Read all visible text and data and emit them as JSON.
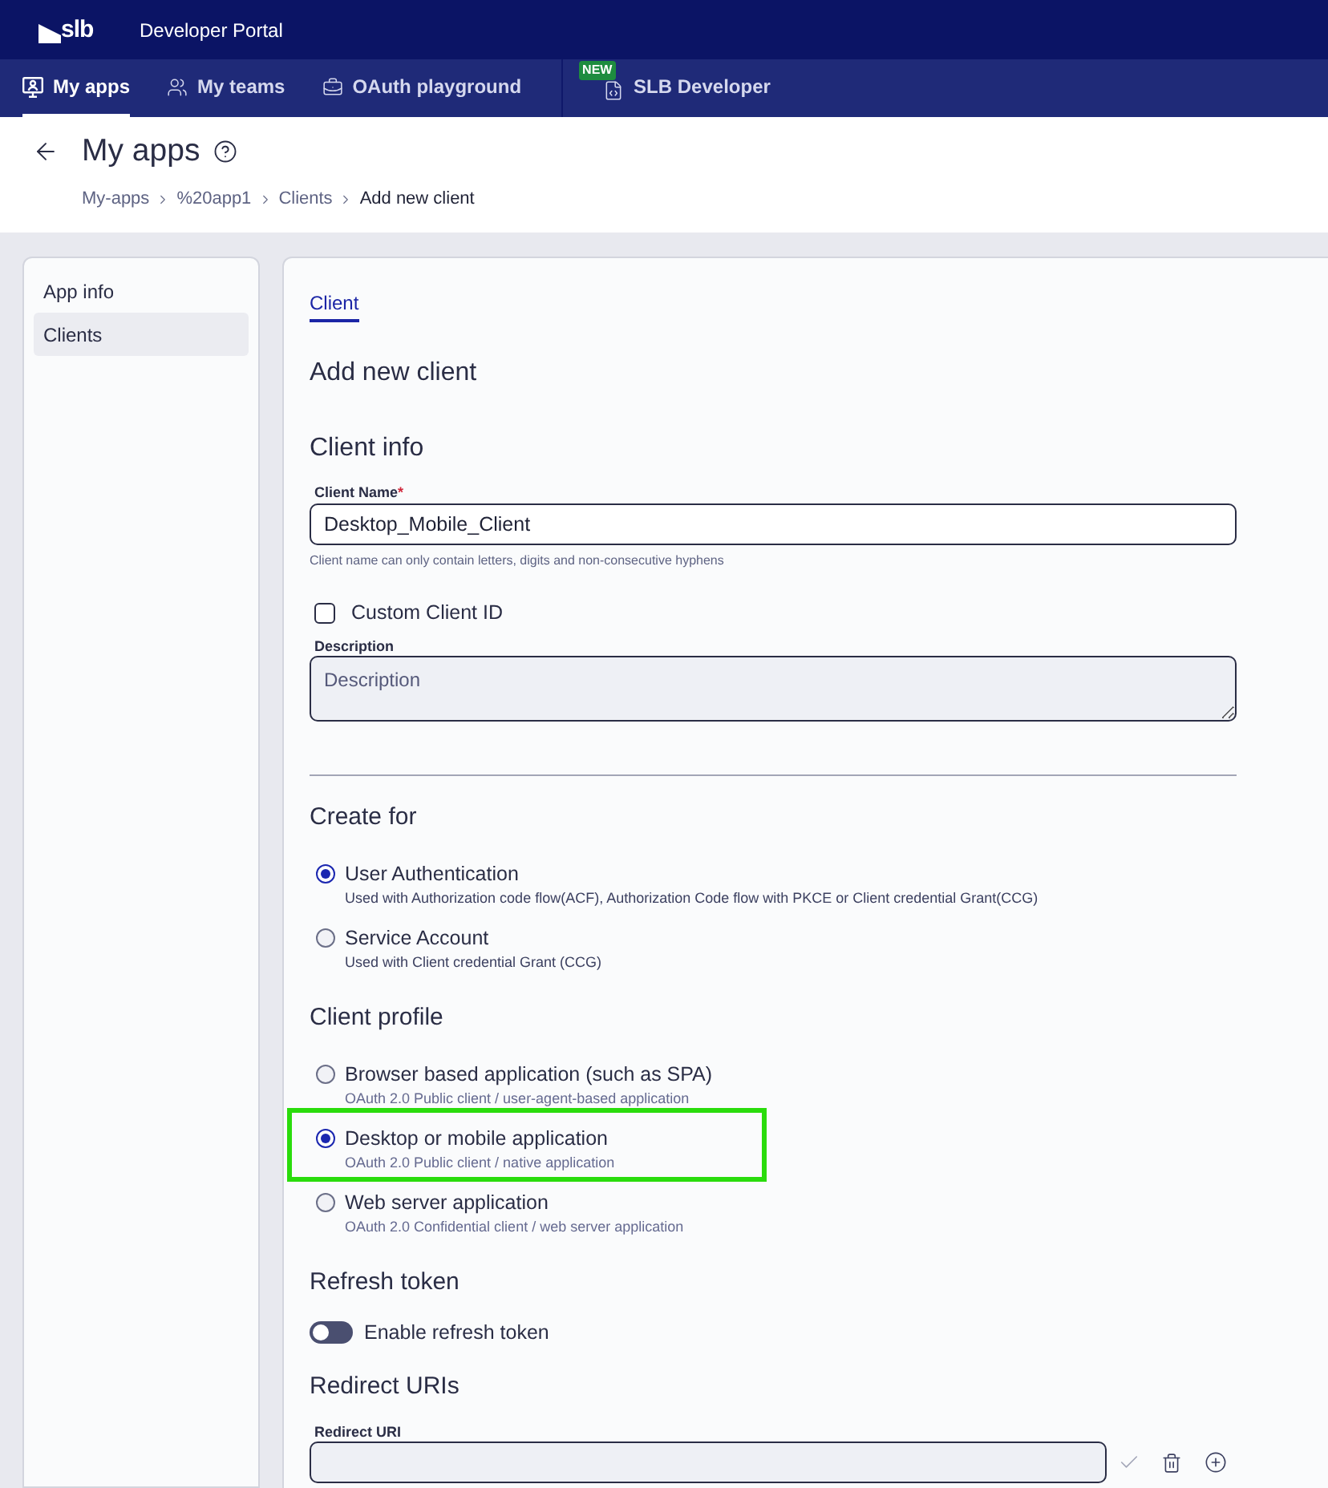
{
  "top_bar": {
    "logo_text": "slb",
    "title": "Developer Portal"
  },
  "nav": {
    "items": [
      {
        "label": "My apps",
        "selected": true
      },
      {
        "label": "My teams",
        "selected": false
      },
      {
        "label": "OAuth playground",
        "selected": false
      },
      {
        "label": "SLB Developer",
        "selected": false,
        "badge": "NEW"
      }
    ]
  },
  "page_header": {
    "title": "My apps",
    "breadcrumb": [
      {
        "label": "My-apps",
        "current": false
      },
      {
        "label": "%20app1",
        "current": false
      },
      {
        "label": "Clients",
        "current": false
      },
      {
        "label": "Add new client",
        "current": true
      }
    ]
  },
  "sidebar": {
    "items": [
      {
        "label": "App info",
        "selected": false
      },
      {
        "label": "Clients",
        "selected": true
      }
    ]
  },
  "form": {
    "tabs": [
      {
        "label": "Client",
        "selected": true
      }
    ],
    "heading": "Add new client"
  },
  "client_info": {
    "title": "Client info",
    "name_field": {
      "label": "Client Name",
      "required_mark": "*",
      "value": "Desktop_Mobile_Client",
      "hint": "Client name can only contain letters, digits and non-consecutive hyphens"
    },
    "custom_id": {
      "label": "Custom Client ID",
      "checked": false
    },
    "description": {
      "label": "Description",
      "placeholder": "Description"
    }
  },
  "create_for": {
    "title": "Create for",
    "options": [
      {
        "label": "User Authentication",
        "description": "Used with Authorization code flow(ACF), Authorization Code flow with PKCE or Client credential Grant(CCG)",
        "selected": true,
        "highlighted": false
      },
      {
        "label": "Service Account",
        "description": "Used with Client credential Grant (CCG)",
        "selected": false,
        "highlighted": false
      }
    ]
  },
  "client_profile": {
    "title": "Client profile",
    "options": [
      {
        "label": "Browser based application (such as SPA)",
        "description": "OAuth 2.0 Public client / user-agent-based application",
        "selected": false,
        "highlighted": false
      },
      {
        "label": "Desktop or mobile application",
        "description": "OAuth 2.0 Public client / native application",
        "selected": true,
        "highlighted": true
      },
      {
        "label": "Web server application",
        "description": "OAuth 2.0 Confidential client / web server application",
        "selected": false,
        "highlighted": false
      }
    ]
  },
  "refresh_token": {
    "title": "Refresh token",
    "toggle": {
      "label": "Enable refresh token",
      "on": false
    }
  },
  "redirect_uris": {
    "title": "Redirect URIs",
    "field": {
      "label": "Redirect URI"
    }
  }
}
